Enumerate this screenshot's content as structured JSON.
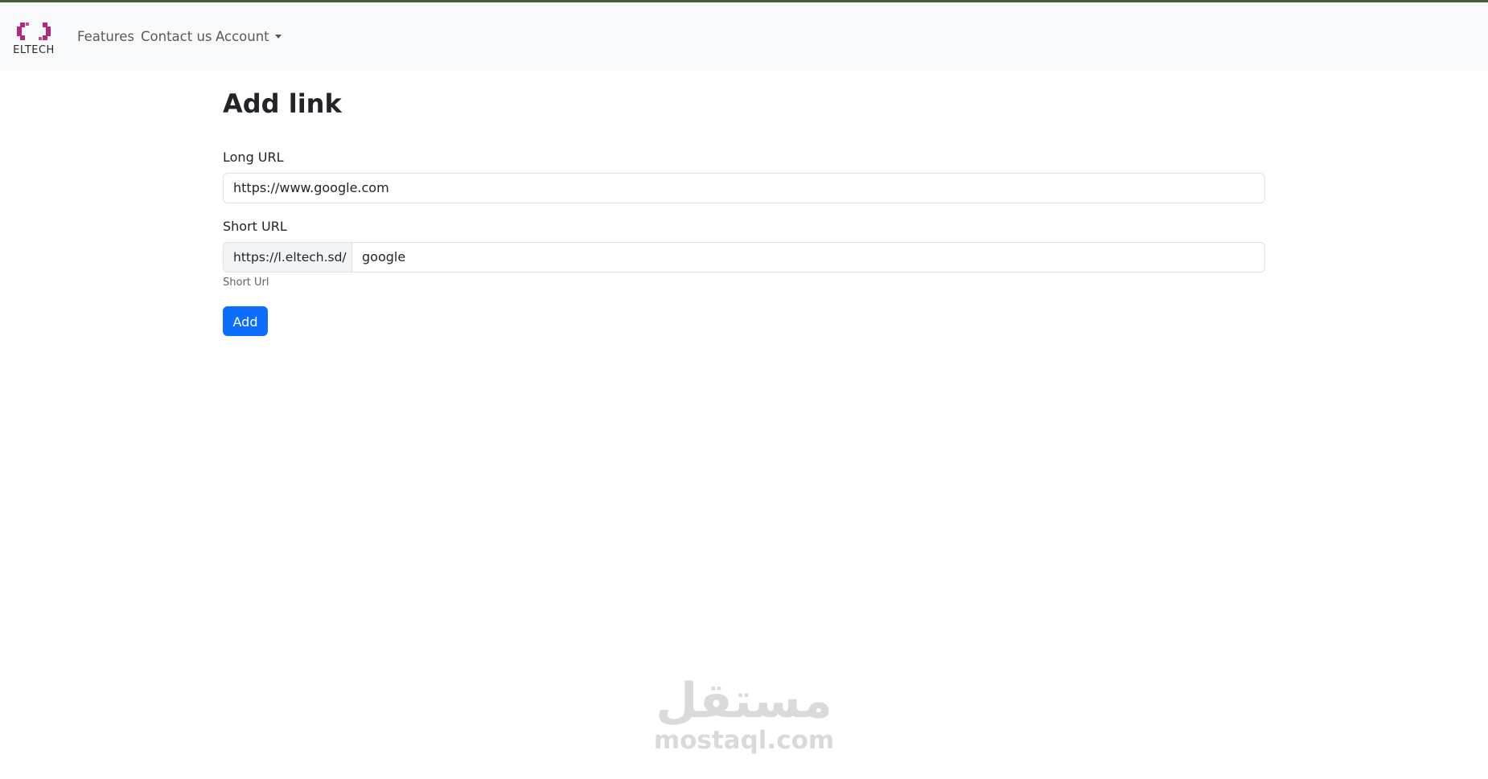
{
  "brand": {
    "name": "ELTECH",
    "accent_color": "#b3287d"
  },
  "nav": {
    "features": "Features",
    "contact": "Contact us",
    "account": "Account"
  },
  "page": {
    "title": "Add link"
  },
  "form": {
    "long_url_label": "Long URL",
    "long_url_value": "https://www.google.com",
    "short_url_label": "Short URL",
    "short_url_prefix": "https://l.eltech.sd/",
    "short_url_value": "google",
    "short_url_help": "Short Url",
    "submit_label": "Add",
    "submit_color": "#0d6efd"
  },
  "watermark": {
    "arabic": "مستقل",
    "latin": "mostaql.com"
  }
}
